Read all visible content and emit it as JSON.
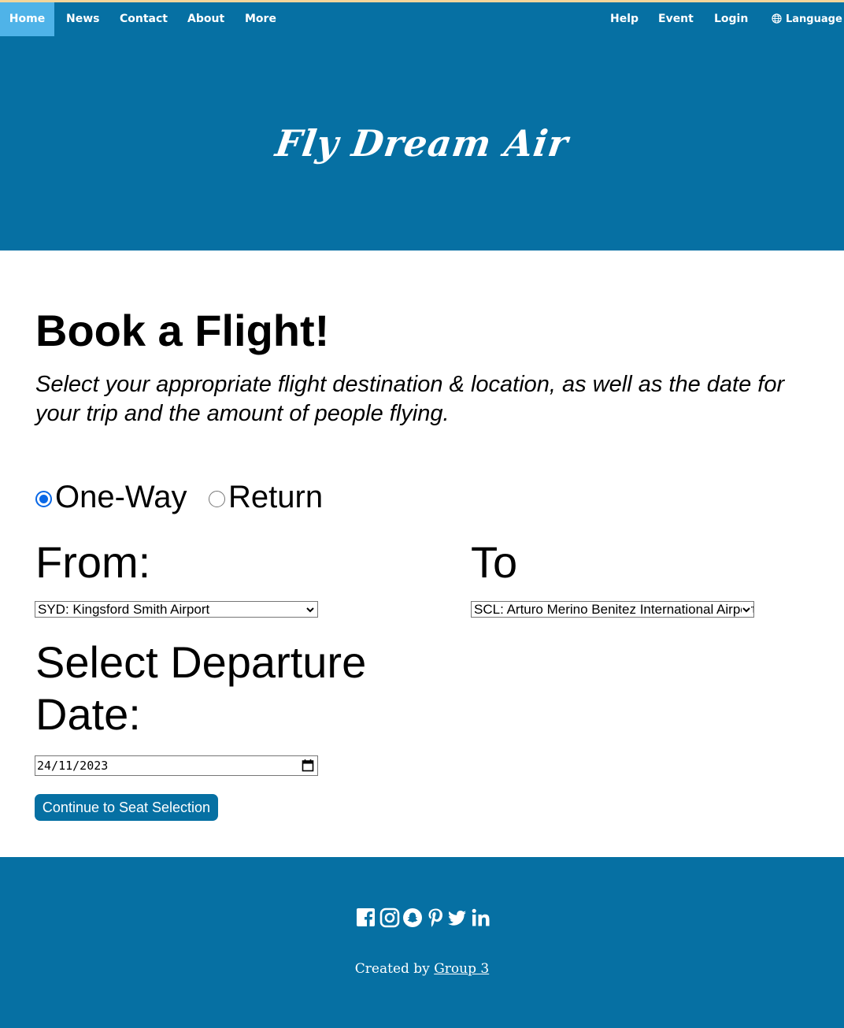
{
  "nav": {
    "left": [
      {
        "label": "Home",
        "active": true
      },
      {
        "label": "News"
      },
      {
        "label": "Contact"
      },
      {
        "label": "About"
      },
      {
        "label": "More"
      }
    ],
    "right": [
      {
        "label": "Help"
      },
      {
        "label": "Event"
      },
      {
        "label": "Login"
      }
    ],
    "language": {
      "label": "Language",
      "icon": "globe-icon"
    }
  },
  "hero": {
    "logo_text": "Fly Dream Air"
  },
  "booking": {
    "title": "Book a Flight!",
    "subtitle": "Select your appropriate flight destination & location, as well as the date for your trip and the amount of people flying.",
    "trip_type": {
      "options": [
        "One-Way",
        "Return"
      ],
      "selected": "One-Way"
    },
    "from_label": "From:",
    "to_label": "To",
    "from_value": "SYD: Kingsford Smith Airport",
    "to_value": "SCL: Arturo Merino Benitez International Airport",
    "date_label": "Select Departure Date:",
    "date_value": "24/11/2023",
    "continue_label": "Continue to Seat Selection"
  },
  "footer": {
    "social_icons": [
      "facebook-icon",
      "instagram-icon",
      "snapchat-icon",
      "pinterest-icon",
      "twitter-icon",
      "linkedin-icon"
    ],
    "credit_prefix": "Created by ",
    "credit_link": "Group 3"
  },
  "colors": {
    "brand_blue": "#0670a3",
    "active_tab": "#4fb3e8",
    "radio_accent": "#0a68e6",
    "top_stripe": "#f3d59a"
  }
}
